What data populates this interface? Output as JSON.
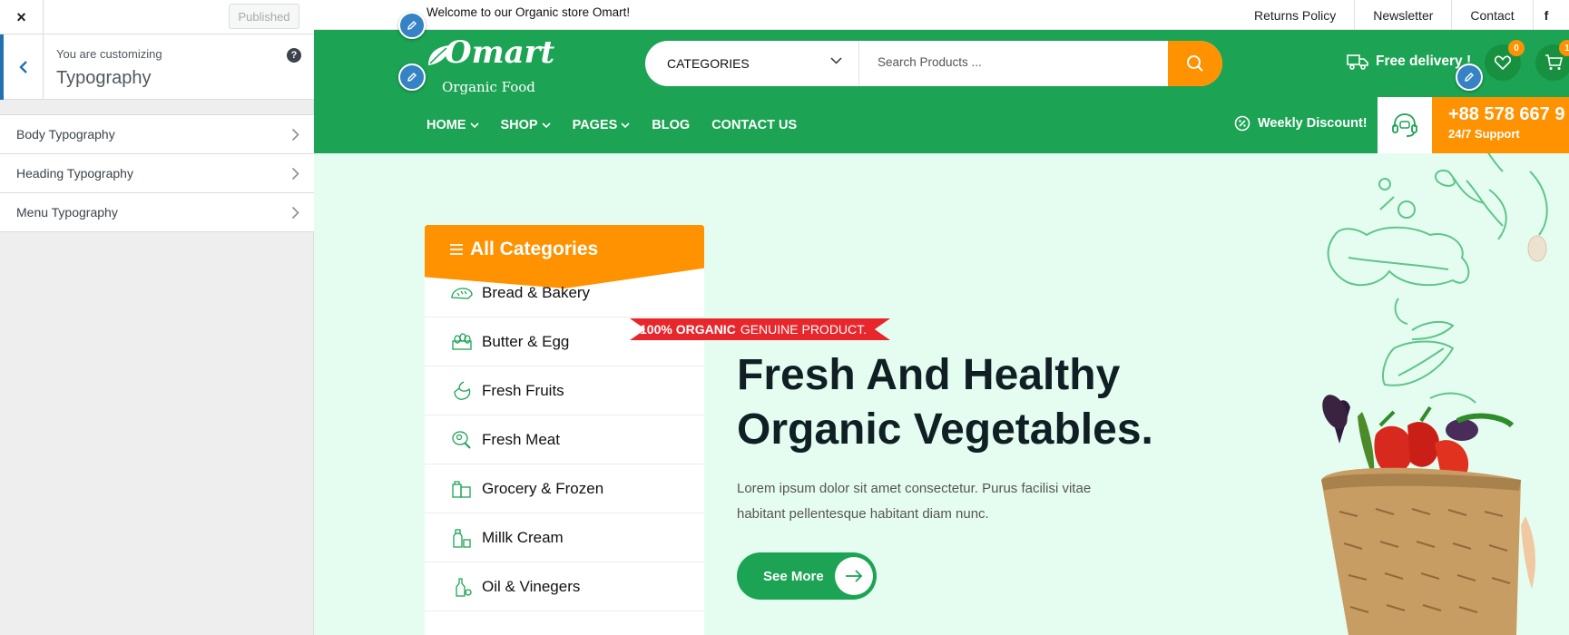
{
  "customizer": {
    "close": "×",
    "published": "Published",
    "subtitle": "You are customizing",
    "title": "Typography",
    "help": "?",
    "sections": [
      {
        "label": "Body Typography"
      },
      {
        "label": "Heading Typography"
      },
      {
        "label": "Menu Typography"
      }
    ]
  },
  "site": {
    "topbar": {
      "welcome": "Welcome to our Organic store Omart!",
      "links": [
        "Returns Policy",
        "Newsletter",
        "Contact"
      ],
      "social": "f"
    },
    "header": {
      "logo_name": "Omart",
      "logo_sub": "Organic Food",
      "categories_label": "CATEGORIES",
      "search_placeholder": "Search Products ...",
      "delivery": "Free delivery !",
      "wishlist_count": "0",
      "cart_count": "1"
    },
    "nav": {
      "items": [
        "HOME",
        "SHOP",
        "PAGES",
        "BLOG",
        "CONTACT US"
      ],
      "weekly": "Weekly Discount!",
      "phone": "+88 578 667 9",
      "support": "24/7 Support"
    },
    "sidebar_categories": {
      "title": "All Categories",
      "items": [
        "Bread & Bakery",
        "Butter & Egg",
        "Fresh Fruits",
        "Fresh Meat",
        "Grocery & Frozen",
        "Millk Cream",
        "Oil & Vinegers"
      ]
    },
    "hero": {
      "ribbon_bold": "100% ORGANIC",
      "ribbon_rest": "GENUINE PRODUCT.",
      "headline_line1": "Fresh And Healthy",
      "headline_line2": "Organic Vegetables.",
      "text": "Lorem ipsum dolor sit amet consectetur. Purus facilisi vitae habitant pellentesque habitant diam nunc.",
      "button": "See More"
    }
  },
  "colors": {
    "brand_green": "#1ca354",
    "accent_orange": "#ff9200",
    "ribbon_red": "#e8272d",
    "hero_bg": "#e5fdf0",
    "customizer_blue": "#2271b1"
  }
}
